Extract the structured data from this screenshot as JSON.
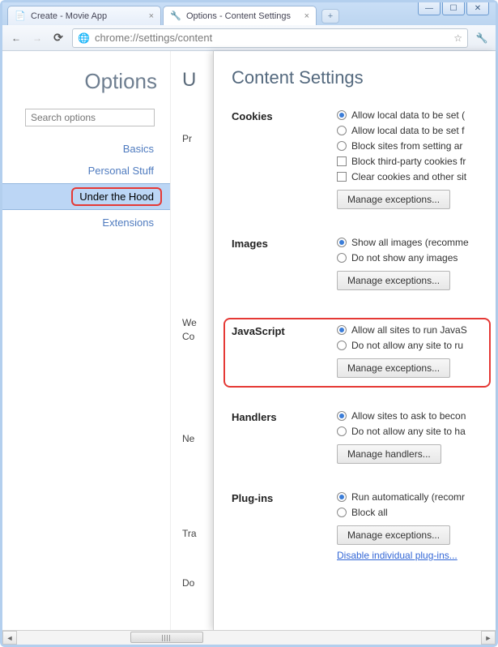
{
  "window": {
    "minimize": "—",
    "maximize": "☐",
    "close": "✕"
  },
  "tabs": {
    "items": [
      {
        "title": "Create - Movie App",
        "favicon": "📄"
      },
      {
        "title": "Options - Content Settings",
        "favicon": "🔧"
      }
    ],
    "new": "+"
  },
  "toolbar": {
    "back": "←",
    "forward": "→",
    "reload": "⟳",
    "globe": "🌐",
    "url": "chrome://settings/content",
    "star": "☆",
    "wrench": "🔧"
  },
  "sidebar": {
    "title": "Options",
    "search_placeholder": "Search options",
    "items": [
      {
        "label": "Basics"
      },
      {
        "label": "Personal Stuff"
      },
      {
        "label": "Under the Hood"
      },
      {
        "label": "Extensions"
      }
    ]
  },
  "underpage": {
    "title_initial": "U",
    "sections": [
      "Pr",
      "We\nCo",
      "Ne",
      "Tra",
      "Do"
    ]
  },
  "overlay": {
    "title": "Content Settings",
    "cookies": {
      "label": "Cookies",
      "opts": [
        "Allow local data to be set (",
        "Allow local data to be set f",
        "Block sites from setting ar"
      ],
      "chks": [
        "Block third-party cookies fr",
        "Clear cookies and other sit"
      ],
      "btn": "Manage exceptions..."
    },
    "images": {
      "label": "Images",
      "opts": [
        "Show all images (recomme",
        "Do not show any images"
      ],
      "btn": "Manage exceptions..."
    },
    "javascript": {
      "label": "JavaScript",
      "opts": [
        "Allow all sites to run JavaS",
        "Do not allow any site to ru"
      ],
      "btn": "Manage exceptions..."
    },
    "handlers": {
      "label": "Handlers",
      "opts": [
        "Allow sites to ask to becon",
        "Do not allow any site to ha"
      ],
      "btn": "Manage handlers..."
    },
    "plugins": {
      "label": "Plug-ins",
      "opts": [
        "Run automatically (recomr",
        "Block all"
      ],
      "btn": "Manage exceptions...",
      "link": "Disable individual plug-ins..."
    }
  }
}
